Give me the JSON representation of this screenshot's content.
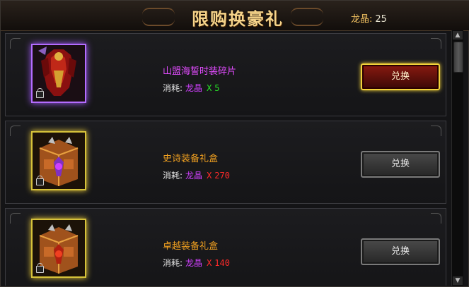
{
  "header": {
    "title": "限购换豪礼",
    "currency_label": "龙晶",
    "currency_sep": ":",
    "currency_value": "25"
  },
  "items": [
    {
      "name": "山盟海誓时装碎片",
      "name_color": "#e24cff",
      "cost_label": "消耗:",
      "cost_currency": "龙晶",
      "cost_x": "X",
      "cost_qty": "5",
      "qty_color": "#28e028",
      "frame": "purple",
      "icon": "fashion-armor-icon",
      "button_label": "兑换",
      "button_state": "active"
    },
    {
      "name": "史诗装备礼盒",
      "name_color": "#f0a020",
      "cost_label": "消耗:",
      "cost_currency": "龙晶",
      "cost_x": "X",
      "cost_qty": "270",
      "qty_color": "#ff2a2a",
      "frame": "gold",
      "icon": "treasure-chest-icon",
      "button_label": "兑换",
      "button_state": "disabled"
    },
    {
      "name": "卓越装备礼盒",
      "name_color": "#f0a020",
      "cost_label": "消耗:",
      "cost_currency": "龙晶",
      "cost_x": "X",
      "cost_qty": "140",
      "qty_color": "#ff2a2a",
      "frame": "gold",
      "icon": "treasure-chest-icon",
      "button_label": "兑换",
      "button_state": "disabled"
    }
  ],
  "scrollbar": {
    "up_icon": "scroll-up-arrow-icon",
    "down_icon": "scroll-down-arrow-icon"
  }
}
